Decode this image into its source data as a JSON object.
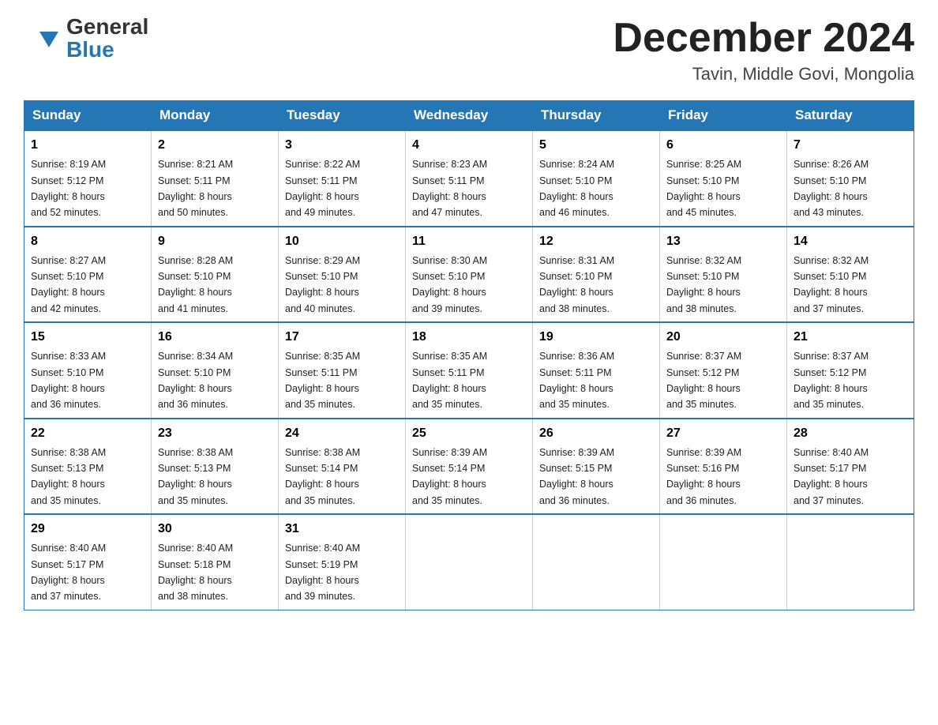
{
  "header": {
    "logo_general": "General",
    "logo_blue": "Blue",
    "month_title": "December 2024",
    "location": "Tavin, Middle Govi, Mongolia"
  },
  "days_of_week": [
    "Sunday",
    "Monday",
    "Tuesday",
    "Wednesday",
    "Thursday",
    "Friday",
    "Saturday"
  ],
  "weeks": [
    [
      {
        "day": "1",
        "sunrise": "8:19 AM",
        "sunset": "5:12 PM",
        "daylight": "8 hours and 52 minutes."
      },
      {
        "day": "2",
        "sunrise": "8:21 AM",
        "sunset": "5:11 PM",
        "daylight": "8 hours and 50 minutes."
      },
      {
        "day": "3",
        "sunrise": "8:22 AM",
        "sunset": "5:11 PM",
        "daylight": "8 hours and 49 minutes."
      },
      {
        "day": "4",
        "sunrise": "8:23 AM",
        "sunset": "5:11 PM",
        "daylight": "8 hours and 47 minutes."
      },
      {
        "day": "5",
        "sunrise": "8:24 AM",
        "sunset": "5:10 PM",
        "daylight": "8 hours and 46 minutes."
      },
      {
        "day": "6",
        "sunrise": "8:25 AM",
        "sunset": "5:10 PM",
        "daylight": "8 hours and 45 minutes."
      },
      {
        "day": "7",
        "sunrise": "8:26 AM",
        "sunset": "5:10 PM",
        "daylight": "8 hours and 43 minutes."
      }
    ],
    [
      {
        "day": "8",
        "sunrise": "8:27 AM",
        "sunset": "5:10 PM",
        "daylight": "8 hours and 42 minutes."
      },
      {
        "day": "9",
        "sunrise": "8:28 AM",
        "sunset": "5:10 PM",
        "daylight": "8 hours and 41 minutes."
      },
      {
        "day": "10",
        "sunrise": "8:29 AM",
        "sunset": "5:10 PM",
        "daylight": "8 hours and 40 minutes."
      },
      {
        "day": "11",
        "sunrise": "8:30 AM",
        "sunset": "5:10 PM",
        "daylight": "8 hours and 39 minutes."
      },
      {
        "day": "12",
        "sunrise": "8:31 AM",
        "sunset": "5:10 PM",
        "daylight": "8 hours and 38 minutes."
      },
      {
        "day": "13",
        "sunrise": "8:32 AM",
        "sunset": "5:10 PM",
        "daylight": "8 hours and 38 minutes."
      },
      {
        "day": "14",
        "sunrise": "8:32 AM",
        "sunset": "5:10 PM",
        "daylight": "8 hours and 37 minutes."
      }
    ],
    [
      {
        "day": "15",
        "sunrise": "8:33 AM",
        "sunset": "5:10 PM",
        "daylight": "8 hours and 36 minutes."
      },
      {
        "day": "16",
        "sunrise": "8:34 AM",
        "sunset": "5:10 PM",
        "daylight": "8 hours and 36 minutes."
      },
      {
        "day": "17",
        "sunrise": "8:35 AM",
        "sunset": "5:11 PM",
        "daylight": "8 hours and 35 minutes."
      },
      {
        "day": "18",
        "sunrise": "8:35 AM",
        "sunset": "5:11 PM",
        "daylight": "8 hours and 35 minutes."
      },
      {
        "day": "19",
        "sunrise": "8:36 AM",
        "sunset": "5:11 PM",
        "daylight": "8 hours and 35 minutes."
      },
      {
        "day": "20",
        "sunrise": "8:37 AM",
        "sunset": "5:12 PM",
        "daylight": "8 hours and 35 minutes."
      },
      {
        "day": "21",
        "sunrise": "8:37 AM",
        "sunset": "5:12 PM",
        "daylight": "8 hours and 35 minutes."
      }
    ],
    [
      {
        "day": "22",
        "sunrise": "8:38 AM",
        "sunset": "5:13 PM",
        "daylight": "8 hours and 35 minutes."
      },
      {
        "day": "23",
        "sunrise": "8:38 AM",
        "sunset": "5:13 PM",
        "daylight": "8 hours and 35 minutes."
      },
      {
        "day": "24",
        "sunrise": "8:38 AM",
        "sunset": "5:14 PM",
        "daylight": "8 hours and 35 minutes."
      },
      {
        "day": "25",
        "sunrise": "8:39 AM",
        "sunset": "5:14 PM",
        "daylight": "8 hours and 35 minutes."
      },
      {
        "day": "26",
        "sunrise": "8:39 AM",
        "sunset": "5:15 PM",
        "daylight": "8 hours and 36 minutes."
      },
      {
        "day": "27",
        "sunrise": "8:39 AM",
        "sunset": "5:16 PM",
        "daylight": "8 hours and 36 minutes."
      },
      {
        "day": "28",
        "sunrise": "8:40 AM",
        "sunset": "5:17 PM",
        "daylight": "8 hours and 37 minutes."
      }
    ],
    [
      {
        "day": "29",
        "sunrise": "8:40 AM",
        "sunset": "5:17 PM",
        "daylight": "8 hours and 37 minutes."
      },
      {
        "day": "30",
        "sunrise": "8:40 AM",
        "sunset": "5:18 PM",
        "daylight": "8 hours and 38 minutes."
      },
      {
        "day": "31",
        "sunrise": "8:40 AM",
        "sunset": "5:19 PM",
        "daylight": "8 hours and 39 minutes."
      },
      null,
      null,
      null,
      null
    ]
  ],
  "labels": {
    "sunrise": "Sunrise:",
    "sunset": "Sunset:",
    "daylight": "Daylight:"
  }
}
